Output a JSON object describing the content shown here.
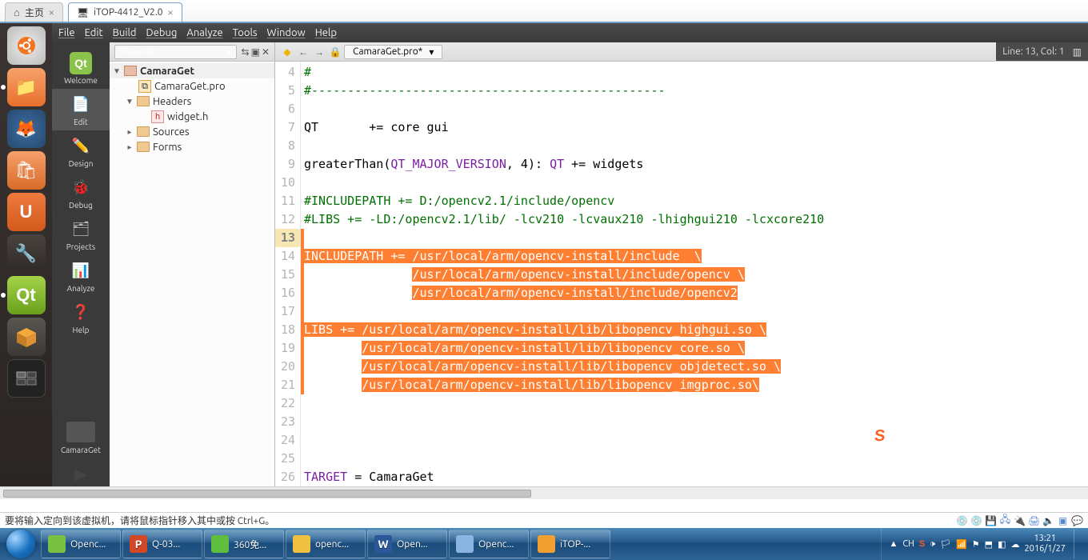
{
  "outerTabs": {
    "home": "主页",
    "active": "iTOP-4412_V2.0"
  },
  "menubar": [
    "File",
    "Edit",
    "Build",
    "Debug",
    "Analyze",
    "Tools",
    "Window",
    "Help"
  ],
  "modes": {
    "welcome": "Welcome",
    "edit": "Edit",
    "design": "Design",
    "debug": "Debug",
    "projects": "Projects",
    "analyze": "Analyze",
    "help": "Help"
  },
  "modeTarget": "CamaraGet",
  "tree": {
    "selector": "Projects",
    "root": "CamaraGet",
    "pro": "CamaraGet.pro",
    "headers": "Headers",
    "widgeth": "widget.h",
    "sources": "Sources",
    "forms": "Forms"
  },
  "editor": {
    "file": "CamaraGet.pro*",
    "pos": "Line: 13, Col: 1",
    "lines": [
      {
        "n": 4,
        "segs": [
          {
            "t": "#",
            "cls": "c-comment"
          }
        ]
      },
      {
        "n": 5,
        "segs": [
          {
            "t": "#-------------------------------------------------",
            "cls": "c-comment"
          }
        ]
      },
      {
        "n": 6,
        "segs": [
          {
            "t": ""
          }
        ]
      },
      {
        "n": 7,
        "segs": [
          {
            "t": "QT       += core gui"
          }
        ]
      },
      {
        "n": 8,
        "segs": [
          {
            "t": ""
          }
        ]
      },
      {
        "n": 9,
        "segs": [
          {
            "t": "greaterThan("
          },
          {
            "t": "QT_MAJOR_VERSION",
            "cls": "c-key"
          },
          {
            "t": ", 4): "
          },
          {
            "t": "QT",
            "cls": "c-dire"
          },
          {
            "t": " += widgets"
          }
        ]
      },
      {
        "n": 10,
        "segs": [
          {
            "t": ""
          }
        ]
      },
      {
        "n": 11,
        "segs": [
          {
            "t": "#INCLUDEPATH += D:/opencv2.1/include/opencv",
            "cls": "c-comment"
          }
        ]
      },
      {
        "n": 12,
        "segs": [
          {
            "t": "#LIBS += -LD:/opencv2.1/lib/ -lcv210 -lcvaux210 -lhighgui210 -lcxcore210",
            "cls": "c-comment"
          }
        ]
      },
      {
        "n": 13,
        "curr": true,
        "segs": [
          {
            "t": ""
          }
        ],
        "selmark": true
      },
      {
        "n": 14,
        "segs": [
          {
            "t": "INCLUDEPATH += /usr/local/arm/opencv-install/include  \\",
            "cls": "sel"
          }
        ],
        "selmark": true
      },
      {
        "n": 15,
        "segs": [
          {
            "t": "               "
          },
          {
            "t": "/usr/local/arm/opencv-install/include/opencv \\",
            "cls": "sel"
          }
        ],
        "selmark": true
      },
      {
        "n": 16,
        "segs": [
          {
            "t": "               "
          },
          {
            "t": "/usr/local/arm/opencv-install/include/opencv2",
            "cls": "sel"
          }
        ],
        "selmark": true
      },
      {
        "n": 17,
        "segs": [
          {
            "t": ""
          }
        ],
        "selmark": true
      },
      {
        "n": 18,
        "segs": [
          {
            "t": "LIBS += /usr/local/arm/opencv-install/lib/libopencv_highgui.so \\",
            "cls": "sel"
          }
        ],
        "selmark": true
      },
      {
        "n": 19,
        "segs": [
          {
            "t": "        "
          },
          {
            "t": "/usr/local/arm/opencv-install/lib/libopencv_core.so \\",
            "cls": "sel"
          }
        ],
        "selmark": true
      },
      {
        "n": 20,
        "segs": [
          {
            "t": "        "
          },
          {
            "t": "/usr/local/arm/opencv-install/lib/libopencv_objdetect.so \\",
            "cls": "sel"
          }
        ],
        "selmark": true
      },
      {
        "n": 21,
        "segs": [
          {
            "t": "        "
          },
          {
            "t": "/usr/local/arm/opencv-install/lib/libopencv_imgproc.so\\",
            "cls": "sel"
          }
        ],
        "selmark": true
      },
      {
        "n": 22,
        "segs": [
          {
            "t": ""
          }
        ]
      },
      {
        "n": 23,
        "segs": [
          {
            "t": ""
          }
        ]
      },
      {
        "n": 24,
        "segs": [
          {
            "t": ""
          }
        ]
      },
      {
        "n": 25,
        "segs": [
          {
            "t": ""
          }
        ]
      },
      {
        "n": 26,
        "segs": [
          {
            "t": "TARGET",
            "cls": "c-dire"
          },
          {
            "t": " = CamaraGet"
          }
        ]
      }
    ]
  },
  "vmTip": "要将输入定向到该虚拟机，请将鼠标指针移入其中或按 Ctrl+G。",
  "taskbar": [
    {
      "label": "Openc...",
      "color": "#7ac043"
    },
    {
      "label": "Q-03...",
      "color": "#d24726",
      "pfx": "P"
    },
    {
      "label": "360免...",
      "color": "#5fbf3c"
    },
    {
      "label": "openc...",
      "color": "#f0c040"
    },
    {
      "label": "Open...",
      "color": "#2b579a",
      "pfx": "W"
    },
    {
      "label": "Openc...",
      "color": "#8ab5e1"
    },
    {
      "label": "iTOP-...",
      "color": "#f0a030"
    }
  ],
  "tray": {
    "ime": "CH",
    "time": "13:21",
    "date": "2016/1/27"
  }
}
